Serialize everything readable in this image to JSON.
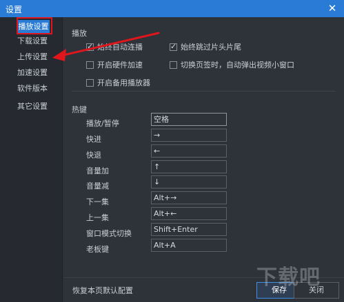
{
  "window": {
    "title": "设置",
    "close_glyph": "✕"
  },
  "sidebar": {
    "items": [
      {
        "label": "播放设置",
        "active": true
      },
      {
        "label": "下载设置",
        "active": false
      },
      {
        "label": "上传设置",
        "active": false
      },
      {
        "label": "加速设置",
        "active": false
      },
      {
        "label": "软件版本",
        "active": false
      },
      {
        "label": "其它设置",
        "active": false
      }
    ]
  },
  "playback": {
    "section_title": "播放",
    "options": [
      {
        "label": "始终自动连播",
        "checked": true
      },
      {
        "label": "始终跳过片头片尾",
        "checked": true
      },
      {
        "label": "开启硬件加速",
        "checked": false
      },
      {
        "label": "切换页签时，自动弹出视频小窗口",
        "checked": false
      },
      {
        "label": "开启备用播放器",
        "checked": false
      }
    ]
  },
  "hotkeys": {
    "section_title": "热键",
    "rows": [
      {
        "label": "播放/暂停",
        "value": "空格"
      },
      {
        "label": "快进",
        "value": "→"
      },
      {
        "label": "快退",
        "value": "←"
      },
      {
        "label": "音量加",
        "value": "↑"
      },
      {
        "label": "音量减",
        "value": "↓"
      },
      {
        "label": "下一集",
        "value": "Alt+→"
      },
      {
        "label": "上一集",
        "value": "Alt+←"
      },
      {
        "label": "窗口模式切换",
        "value": "Shift+Enter"
      },
      {
        "label": "老板键",
        "value": "Alt+A"
      }
    ]
  },
  "footer": {
    "restore_label": "恢复本页默认配置",
    "save_label": "保存",
    "close_label": "关闭"
  },
  "annotation": {
    "color": "#e0161c",
    "icon": "red-arrow-icon"
  },
  "watermark": {
    "text": "下载吧"
  },
  "colors": {
    "accent": "#2a7bd6",
    "background": "#2e3239",
    "sidebar": "#262a30"
  }
}
